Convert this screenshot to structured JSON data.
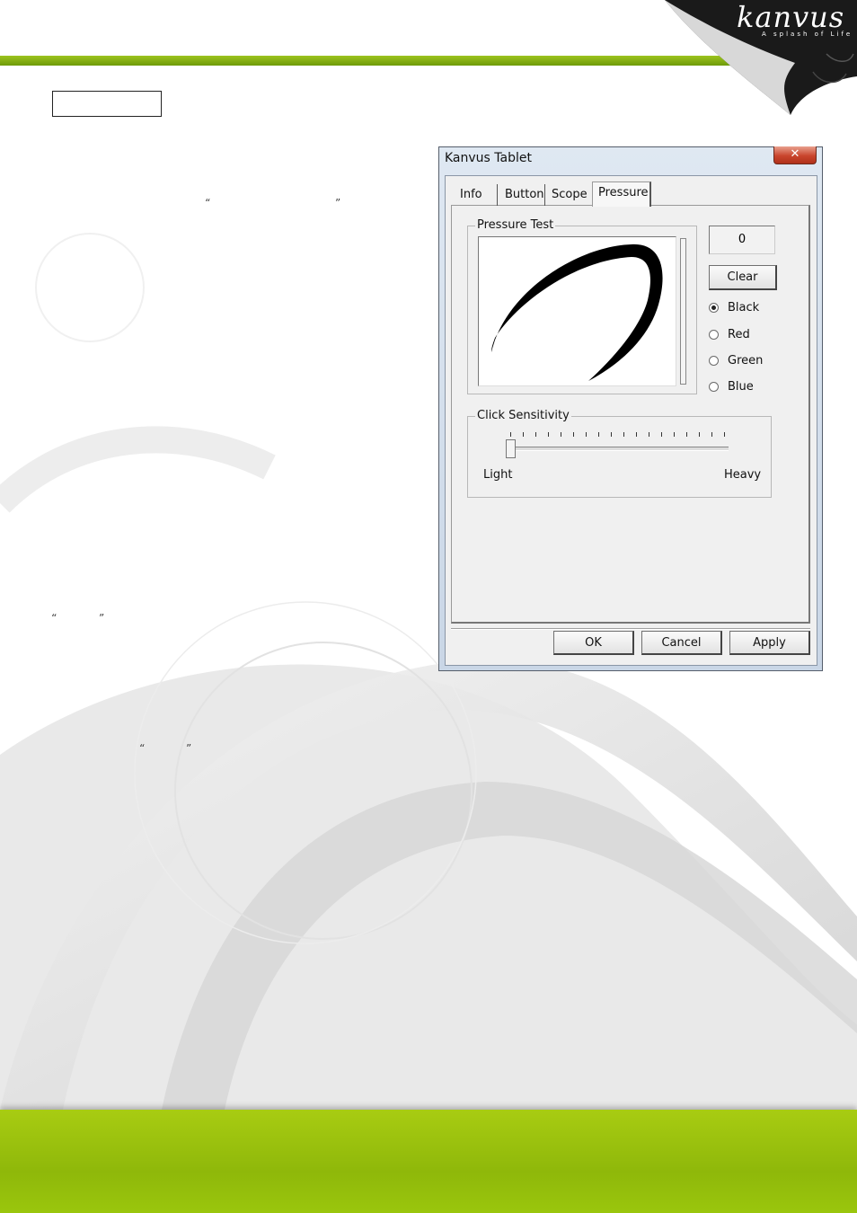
{
  "brand": {
    "logo_text": "kanvus",
    "tagline": "A splash of Life"
  },
  "quotes": {
    "open": "“",
    "close": "”"
  },
  "dialog": {
    "title": "Kanvus Tablet",
    "close_glyph": "✕",
    "tabs": [
      {
        "label": "Info",
        "active": false
      },
      {
        "label": "Button",
        "active": false
      },
      {
        "label": "Scope",
        "active": false
      },
      {
        "label": "Pressure",
        "active": true
      }
    ],
    "pressure_test": {
      "group_label": "Pressure Test",
      "value": "0",
      "clear_label": "Clear",
      "colors": [
        {
          "label": "Black",
          "checked": true
        },
        {
          "label": "Red",
          "checked": false
        },
        {
          "label": "Green",
          "checked": false
        },
        {
          "label": "Blue",
          "checked": false
        }
      ]
    },
    "click_sensitivity": {
      "group_label": "Click Sensitivity",
      "min_label": "Light",
      "max_label": "Heavy",
      "tick_count": 18,
      "level": 0
    },
    "buttons": {
      "ok": "OK",
      "cancel": "Cancel",
      "apply": "Apply"
    }
  },
  "colors": {
    "accent_green": "#8fb80a",
    "close_red": "#c9452d"
  }
}
